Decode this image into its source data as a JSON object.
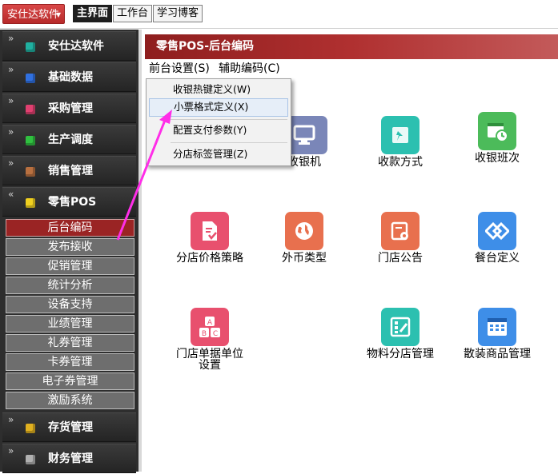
{
  "topbar": {
    "app_button": "安仕达软件",
    "tabs": [
      "主界面",
      "工作台",
      "学习博客"
    ]
  },
  "sidebar": {
    "sections": [
      {
        "label": "安仕达软件",
        "icon": "teal-cube-icon",
        "color": "#20b0a0"
      },
      {
        "label": "基础数据",
        "icon": "blue-cube-icon",
        "color": "#3070e0"
      },
      {
        "label": "采购管理",
        "icon": "pink-cube-icon",
        "color": "#e04070"
      },
      {
        "label": "生产调度",
        "icon": "green-cube-icon",
        "color": "#30c040"
      },
      {
        "label": "销售管理",
        "icon": "brown-cube-icon",
        "color": "#b87040"
      },
      {
        "label": "零售POS",
        "icon": "yellow-cube-icon",
        "color": "#f0d020"
      }
    ],
    "sub_items": [
      "后台编码",
      "发布接收",
      "促销管理",
      "统计分析",
      "设备支持",
      "业绩管理",
      "礼券管理",
      "卡券管理",
      "电子券管理",
      "激励系统"
    ],
    "bottom_sections": [
      {
        "label": "存货管理",
        "icon": "gold-cube-icon",
        "color": "#e0b020"
      },
      {
        "label": "财务管理",
        "icon": "gray-cube-icon",
        "color": "#b0b0b0"
      }
    ]
  },
  "main": {
    "title": "零售POS-后台编码",
    "menus": [
      "前台设置(S)",
      "辅助编码(C)"
    ],
    "dropdown": [
      "收银热键定义(W)",
      "小票格式定义(X)",
      "配置支付参数(Y)",
      "分店标签管理(Z)"
    ],
    "tiles": [
      {
        "label": "收银机",
        "icon": "monitor-icon",
        "color": "#7a86b8"
      },
      {
        "label": "收款方式",
        "icon": "pin-icon",
        "color": "#2cc0b0"
      },
      {
        "label": "收银班次",
        "icon": "calendar-clock-icon",
        "color": "#4cbb5a"
      },
      {
        "label": "分店价格策略",
        "icon": "price-doc-icon",
        "color": "#e8506e"
      },
      {
        "label": "外币类型",
        "icon": "globe-icon",
        "color": "#e8704e"
      },
      {
        "label": "门店公告",
        "icon": "notice-gear-icon",
        "color": "#e8704e"
      },
      {
        "label": "餐台定义",
        "icon": "diamond-link-icon",
        "color": "#3e8ee8"
      },
      {
        "label": "门店单据单位设置",
        "icon": "abc-blocks-icon",
        "color": "#e8506e"
      },
      {
        "label": "物料分店管理",
        "icon": "edit-grid-icon",
        "color": "#2cc0b0"
      },
      {
        "label": "散装商品管理",
        "icon": "table-icon",
        "color": "#3e8ee8"
      }
    ]
  }
}
